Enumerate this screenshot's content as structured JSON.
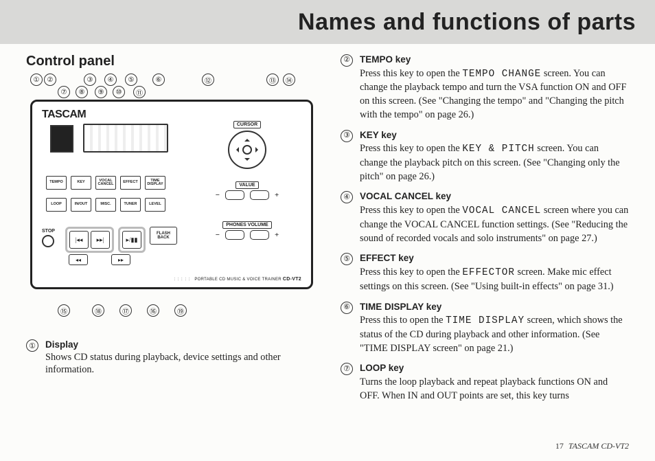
{
  "header": {
    "title": "Names and functions of parts"
  },
  "subhead": "Control panel",
  "diagram": {
    "brand": "TASCAM",
    "cursor_label": "CURSOR",
    "value_label": "VALUE",
    "phones_label": "PHONES VOLUME",
    "stop_label": "STOP",
    "flashback": "FLASH BACK",
    "model_prefix": "PORTABLE CD MUSIC & VOICE TRAINER",
    "model": "CD-VT2",
    "row1": [
      "TEMPO",
      "KEY",
      "VOCAL CANCEL",
      "EFFECT",
      "TIME DISPLAY"
    ],
    "row2": [
      "LOOP",
      "IN/OUT",
      "MISC.",
      "TUNER",
      "LEVEL"
    ],
    "callouts_top": [
      "①",
      "②",
      "③",
      "④",
      "⑤",
      "⑥",
      "⑦",
      "⑧",
      "⑨",
      "⑩",
      "⑪",
      "⑫",
      "⑬",
      "⑭"
    ],
    "callouts_bottom": [
      "⑮",
      "⑱",
      "⑰",
      "⑯",
      "⑲"
    ]
  },
  "items_left": [
    {
      "num": "①",
      "title": "Display",
      "desc_before": "",
      "desc_after": "Shows CD status during playback, device settings and other information."
    }
  ],
  "items_right": [
    {
      "num": "②",
      "title": "TEMPO key",
      "pre": "Press this key to open the ",
      "mono": "TEMPO CHANGE",
      "post": " screen. You can change the playback tempo and turn the VSA function ON and OFF on this screen. (See \"Changing the tempo\" and \"Changing the pitch with the tempo\" on page 26.)"
    },
    {
      "num": "③",
      "title": "KEY key",
      "pre": "Press this key to open the ",
      "mono": "KEY & PITCH",
      "post": " screen. You can change the playback pitch on this screen. (See \"Changing only the pitch\" on page 26.)"
    },
    {
      "num": "④",
      "title": "VOCAL CANCEL key",
      "pre": "Press this key to open the ",
      "mono": "VOCAL CANCEL",
      "post": " screen where you can change the VOCAL CANCEL function settings. (See \"Reducing the sound of recorded vocals and solo instruments\" on page 27.)"
    },
    {
      "num": "⑤",
      "title": "EFFECT key",
      "pre": "Press this key to open the ",
      "mono": "EFFECTOR",
      "post": " screen. Make mic effect settings on this screen. (See \"Using built-in effects\" on page 31.)"
    },
    {
      "num": "⑥",
      "title": "TIME DISPLAY key",
      "pre": "Press this to open the ",
      "mono": "TIME DISPLAY",
      "post": " screen, which shows the status of the CD during playback and other information. (See \"TIME DISPLAY screen\" on page 21.)"
    },
    {
      "num": "⑦",
      "title": "LOOP key",
      "pre": "",
      "mono": "",
      "post": "Turns the loop playback and repeat playback functions ON and OFF. When IN and OUT points are set, this key turns"
    }
  ],
  "footer": {
    "page": "17",
    "product": "TASCAM  CD-VT2"
  }
}
